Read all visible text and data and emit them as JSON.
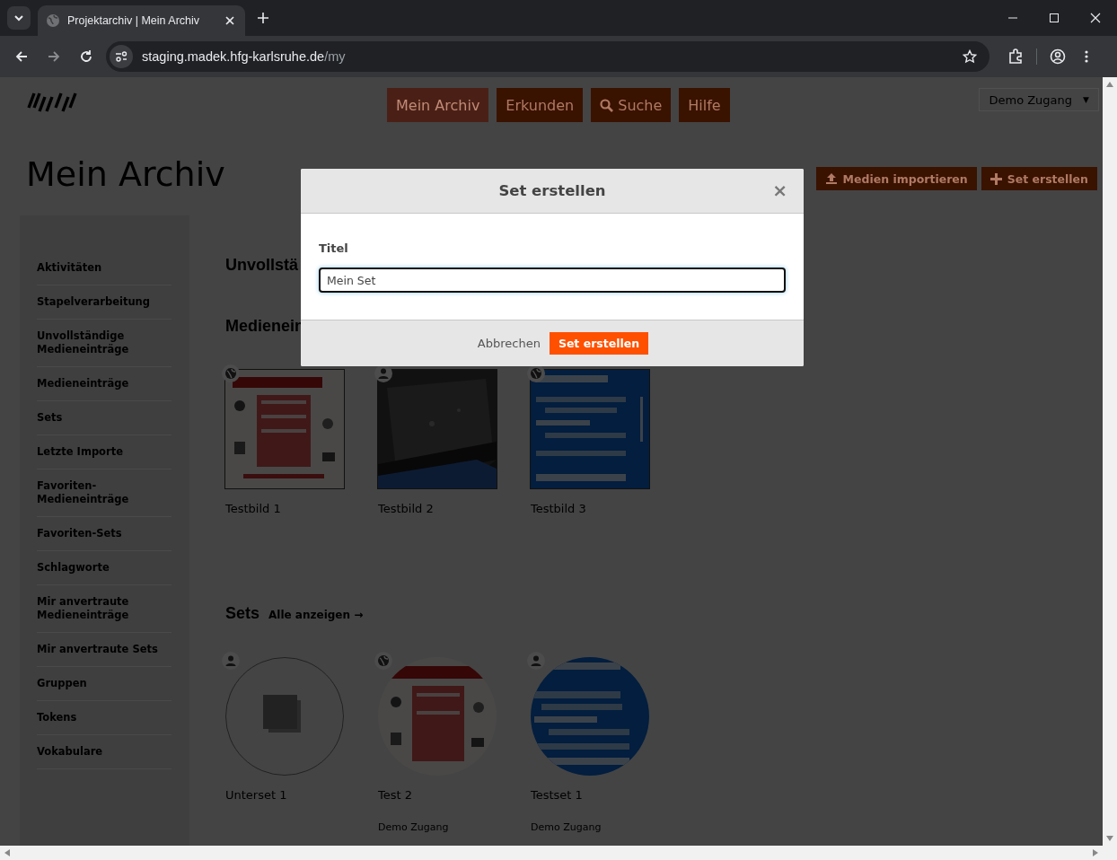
{
  "browser": {
    "tab_title": "Projektarchiv | Mein Archiv",
    "url_host": "staging.madek.hfg-karlsruhe.de",
    "url_path": "/my"
  },
  "nav": [
    {
      "label": "Mein Archiv",
      "selected": true,
      "kind": "text"
    },
    {
      "label": "Erkunden",
      "selected": false,
      "kind": "text"
    },
    {
      "label": "Suche",
      "selected": false,
      "kind": "search"
    },
    {
      "label": "Hilfe",
      "selected": false,
      "kind": "text"
    }
  ],
  "user_menu": {
    "label": "Demo Zugang",
    "caret": "▼"
  },
  "page_title": "Mein Archiv",
  "actions": [
    {
      "label": "Medien importieren",
      "kind": "upload"
    },
    {
      "label": "Set erstellen",
      "kind": "add"
    }
  ],
  "sidebar": {
    "items": [
      "Aktivitäten",
      "Stapelverarbeitung",
      "Unvollständige Medieneinträge",
      "Medieneinträge",
      "Sets",
      "Letzte Importe",
      "Favoriten-Medieneinträge",
      "Favoriten-Sets",
      "Schlagworte",
      "Mir anvertraute Medieneinträge",
      "Mir anvertraute Sets",
      "Gruppen",
      "Tokens",
      "Vokabulare"
    ]
  },
  "sections": {
    "incomplete_heading": "Unvollstä",
    "media_heading": "Medienein"
  },
  "media": [
    {
      "title": "Testbild 1",
      "public": true
    },
    {
      "title": "Testbild 2",
      "public": false
    },
    {
      "title": "Testbild 3",
      "public": true
    }
  ],
  "sets_heading": "Sets",
  "sets_link": "Alle anzeigen →",
  "sets": [
    {
      "title": "Unterset 1",
      "public": false,
      "kind": "empty"
    },
    {
      "title": "Test 2",
      "public": true,
      "kind": "picture",
      "owner": "Demo Zugang"
    },
    {
      "title": "Testset 1",
      "public": false,
      "kind": "picture",
      "owner": "Demo Zugang"
    }
  ],
  "dialog": {
    "title": "Set erstellen",
    "close": "×",
    "field_label": "Titel",
    "value": "Mein Set",
    "cancel": "Abbrechen",
    "submit": "Set erstellen"
  }
}
